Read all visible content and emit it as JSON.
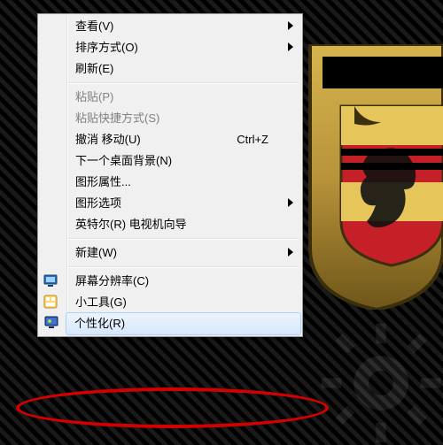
{
  "menu": {
    "items": [
      {
        "label": "查看(V)",
        "submenu": true
      },
      {
        "label": "排序方式(O)",
        "submenu": true
      },
      {
        "label": "刷新(E)"
      },
      {
        "sep": true
      },
      {
        "label": "粘贴(P)",
        "disabled": true
      },
      {
        "label": "粘贴快捷方式(S)",
        "disabled": true
      },
      {
        "label": "撤消 移动(U)",
        "shortcut": "Ctrl+Z"
      },
      {
        "label": "下一个桌面背景(N)"
      },
      {
        "label": "图形属性..."
      },
      {
        "label": "图形选项",
        "submenu": true
      },
      {
        "label": "英特尔(R) 电视机向导"
      },
      {
        "sep": true
      },
      {
        "label": "新建(W)",
        "submenu": true
      },
      {
        "sep": true
      },
      {
        "label": "屏幕分辨率(C)",
        "icon": "resolution-icon"
      },
      {
        "label": "小工具(G)",
        "icon": "gadgets-icon"
      },
      {
        "label": "个性化(R)",
        "icon": "personalize-icon",
        "selected": true
      }
    ]
  },
  "highlight": {
    "target": "个性化(R)"
  }
}
